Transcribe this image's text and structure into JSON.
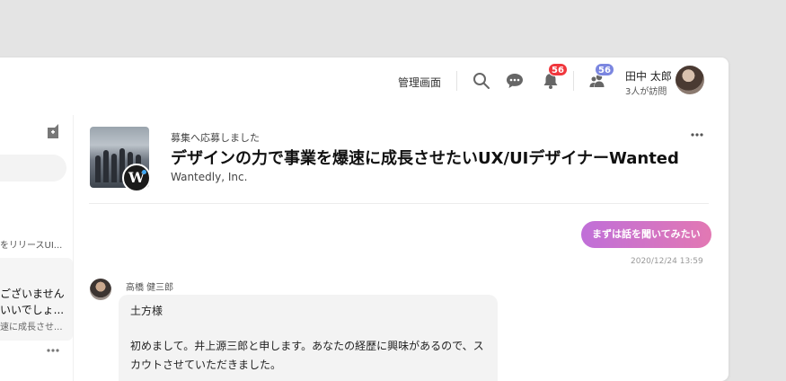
{
  "colors": {
    "background": "#e4e4e4",
    "badge_red": "#f0373d",
    "badge_blue": "#7b86e0",
    "bubble_gradient_start": "#c06fd8",
    "bubble_gradient_end": "#e278b3"
  },
  "header": {
    "admin_label": "管理画面",
    "notifications_count": "56",
    "requests_count": "56",
    "user_name": "田中 太郎",
    "user_sub": "3人が訪問",
    "icons": [
      "search-icon",
      "chat-icon",
      "bell-icon",
      "people-icon"
    ]
  },
  "left_panel": {
    "snippet": "をリリースUI...",
    "card_line1": "ございません",
    "card_line2": "いいでしょ...",
    "card_line3": "速に成長させ..."
  },
  "job": {
    "applied_label": "募集へ応募しました",
    "title": "デザインの力で事業を爆速に成長させたいUX/UIデザイナーWanted",
    "company": "Wantedly, Inc.",
    "logo_letter": "W"
  },
  "messages": {
    "mine_text": "まずは話を聞いてみたい",
    "mine_time": "2020/12/24 13:59",
    "sender_name": "高橋 健三郎",
    "other_line1": "土方様",
    "other_line2": "初めまして。井上源三郎と申します。あなたの経歴に興味があるので、ス",
    "other_line3": "カウトさせていただきました。"
  }
}
